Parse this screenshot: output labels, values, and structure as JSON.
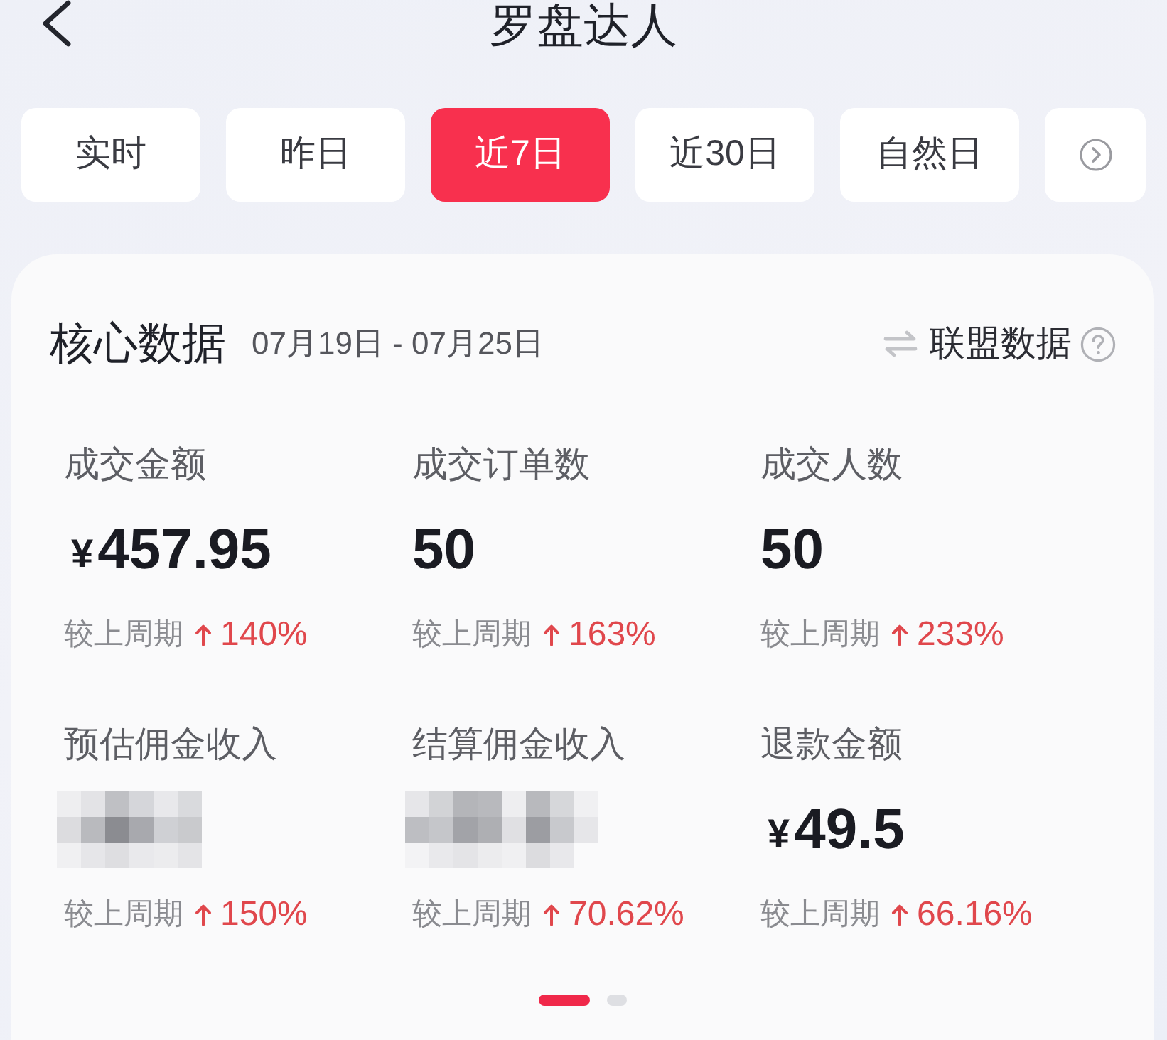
{
  "header": {
    "title": "罗盘达人"
  },
  "tabs": [
    {
      "kind": "text",
      "label": "实时",
      "selected": false
    },
    {
      "kind": "text",
      "label": "昨日",
      "selected": false
    },
    {
      "kind": "text",
      "label": "近7日",
      "selected": true
    },
    {
      "kind": "text",
      "label": "近30日",
      "selected": false
    },
    {
      "kind": "text",
      "label": "自然日",
      "selected": false
    },
    {
      "kind": "more",
      "selected": false
    }
  ],
  "core_data": {
    "title": "核心数据",
    "date_range": "07月19日 - 07月25日",
    "switch_label": "联盟数据",
    "metrics": [
      {
        "kind": "amount",
        "label": "成交金额",
        "currency": "¥",
        "value": "457.95",
        "compare_label": "较上周期",
        "change": "140%"
      },
      {
        "kind": "amount",
        "label": "成交订单数",
        "value": "50",
        "compare_label": "较上周期",
        "change": "163%"
      },
      {
        "kind": "amount",
        "label": "成交人数",
        "value": "50",
        "compare_label": "较上周期",
        "change": "233%"
      },
      {
        "kind": "masked",
        "label": "预估佣金收入",
        "compare_label": "较上周期",
        "change": "150%"
      },
      {
        "kind": "masked",
        "label": "结算佣金收入",
        "compare_label": "较上周期",
        "change": "70.62%"
      },
      {
        "kind": "amount",
        "label": "退款金额",
        "currency": "¥",
        "value": "49.5",
        "compare_label": "较上周期",
        "change": "66.16%"
      }
    ]
  },
  "pager": {
    "pages": [
      {
        "selected": true
      },
      {
        "selected": false
      }
    ]
  }
}
